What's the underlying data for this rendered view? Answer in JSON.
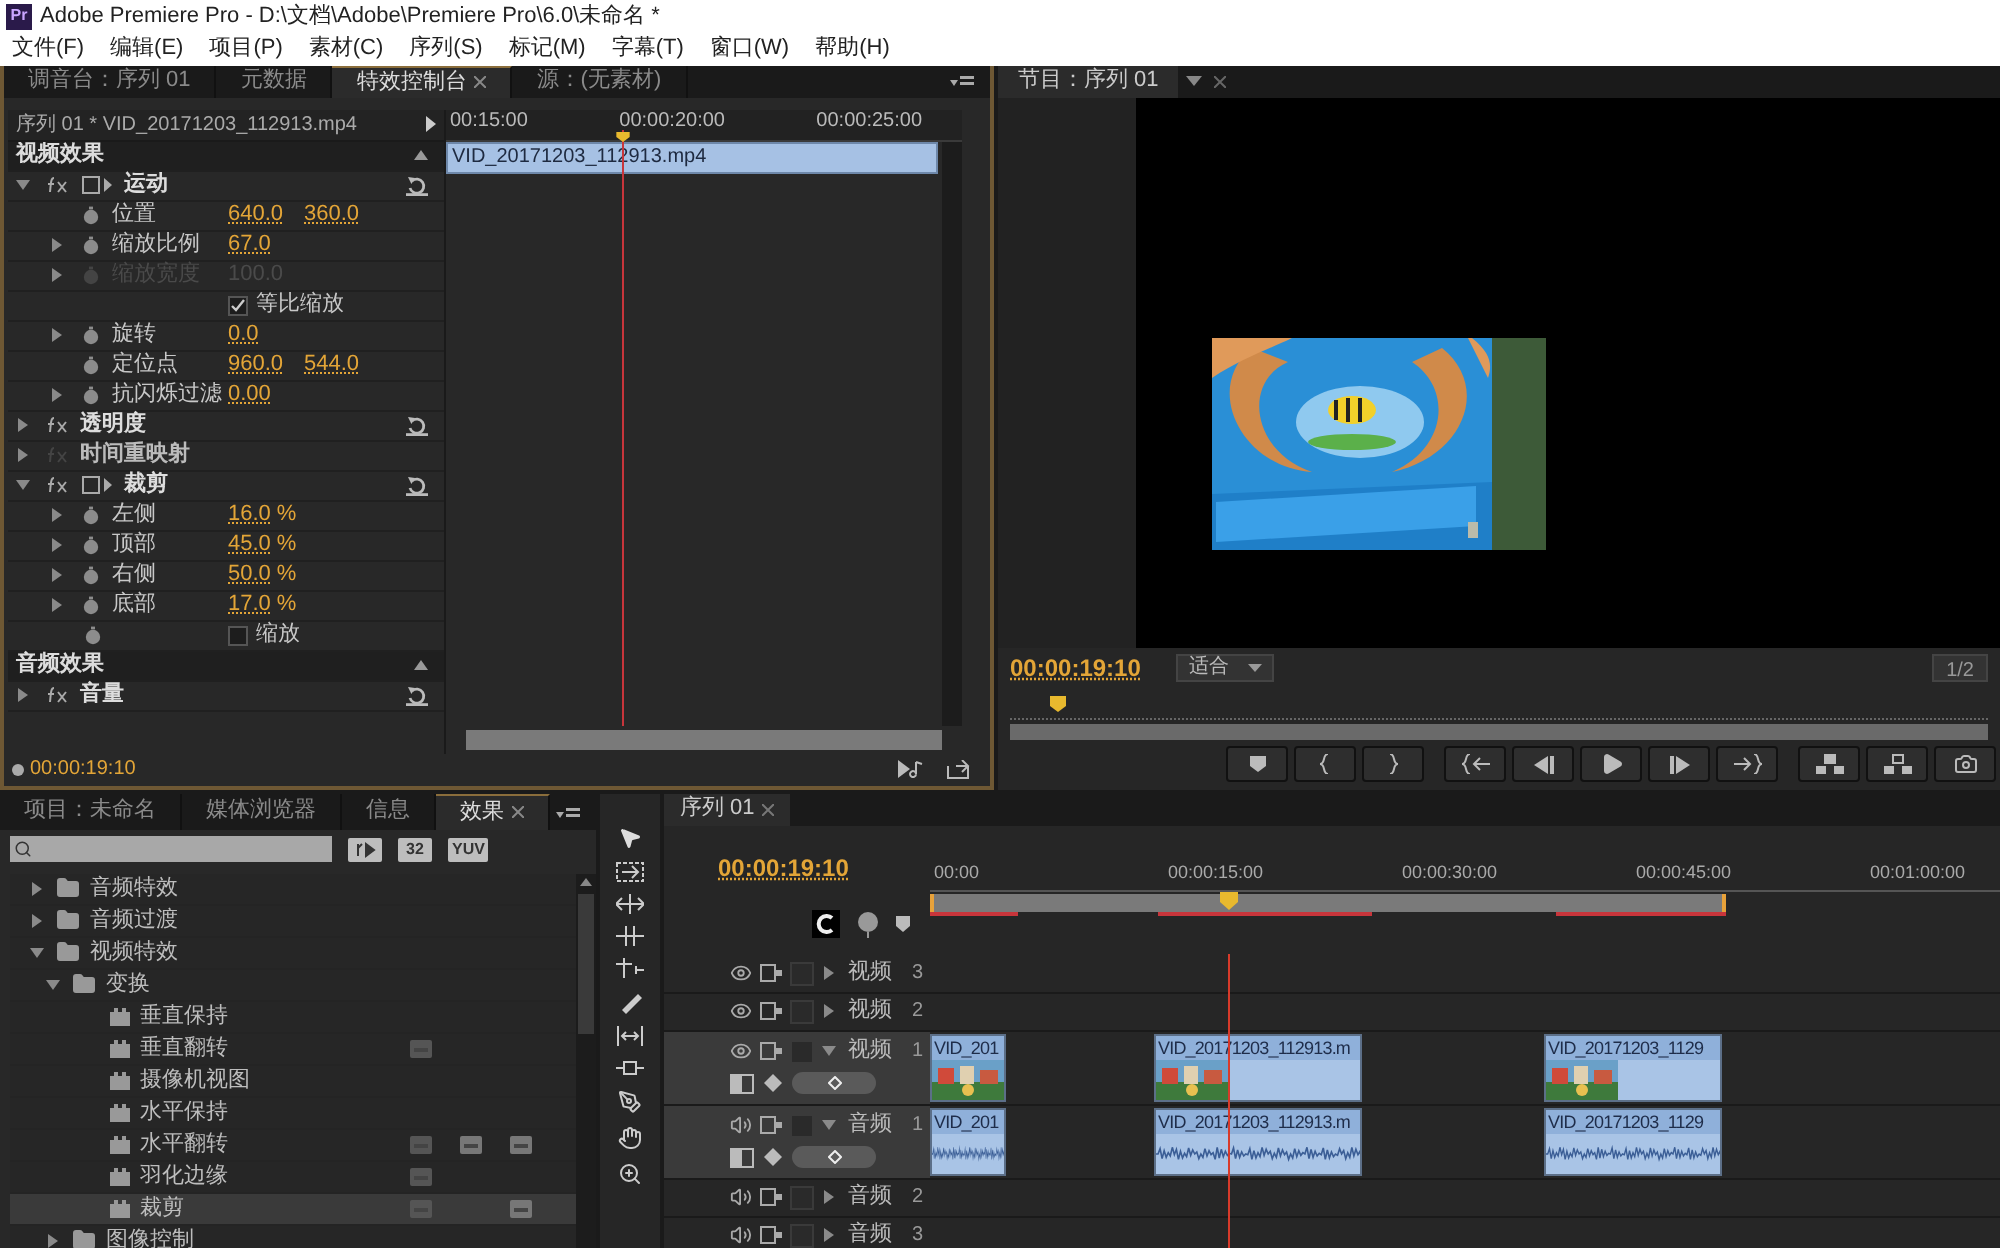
{
  "window": {
    "logo": "Pr",
    "title": "Adobe Premiere Pro - D:\\文档\\Adobe\\Premiere Pro\\6.0\\未命名 *"
  },
  "menu": [
    "文件(F)",
    "编辑(E)",
    "项目(P)",
    "素材(C)",
    "序列(S)",
    "标记(M)",
    "字幕(T)",
    "窗口(W)",
    "帮助(H)"
  ],
  "effect_controls": {
    "tabs": [
      {
        "label": "调音台：序列 01",
        "selected": false
      },
      {
        "label": "元数据",
        "selected": false
      },
      {
        "label": "特效控制台",
        "selected": true
      },
      {
        "label": "源：(无素材)",
        "selected": false
      }
    ],
    "clip_path": "序列 01 * VID_20171203_112913.mp4",
    "ruler": [
      "00:15:00",
      "00:00:20:00",
      "00:00:25:00"
    ],
    "clip_bar": "VID_20171203_112913.mp4",
    "rows": [
      {
        "kind": "section",
        "label": "视频效果"
      },
      {
        "kind": "effect",
        "label": "运动",
        "expanded": true,
        "fx_on": true,
        "transform_icon": true
      },
      {
        "kind": "param",
        "label": "位置",
        "values": [
          "640.0",
          "360.0"
        ],
        "expandable": false,
        "disabled": false
      },
      {
        "kind": "param",
        "label": "缩放比例",
        "values": [
          "67.0"
        ],
        "expandable": true,
        "disabled": false
      },
      {
        "kind": "param",
        "label": "缩放宽度",
        "values": [
          "100.0"
        ],
        "expandable": true,
        "disabled": true
      },
      {
        "kind": "check",
        "label": "等比缩放",
        "checked": true,
        "stopwatch": false
      },
      {
        "kind": "param",
        "label": "旋转",
        "values": [
          "0.0"
        ],
        "expandable": true,
        "disabled": false
      },
      {
        "kind": "param",
        "label": "定位点",
        "values": [
          "960.0",
          "544.0"
        ],
        "expandable": false,
        "disabled": false
      },
      {
        "kind": "param",
        "label": "抗闪烁过滤",
        "values": [
          "0.00"
        ],
        "expandable": true,
        "disabled": false
      },
      {
        "kind": "effect",
        "label": "透明度",
        "expanded": false,
        "fx_on": true,
        "transform_icon": false
      },
      {
        "kind": "effect",
        "label": "时间重映射",
        "expanded": false,
        "fx_on": false,
        "transform_icon": false
      },
      {
        "kind": "effect",
        "label": "裁剪",
        "expanded": true,
        "fx_on": true,
        "transform_icon": true
      },
      {
        "kind": "param",
        "label": "左侧",
        "values": [
          "16.0"
        ],
        "unit": "%",
        "expandable": true,
        "disabled": false
      },
      {
        "kind": "param",
        "label": "顶部",
        "values": [
          "45.0"
        ],
        "unit": "%",
        "expandable": true,
        "disabled": false
      },
      {
        "kind": "param",
        "label": "右侧",
        "values": [
          "50.0"
        ],
        "unit": "%",
        "expandable": true,
        "disabled": false
      },
      {
        "kind": "param",
        "label": "底部",
        "values": [
          "17.0"
        ],
        "unit": "%",
        "expandable": true,
        "disabled": false
      },
      {
        "kind": "check",
        "label": "缩放",
        "checked": false,
        "stopwatch": true
      },
      {
        "kind": "section",
        "label": "音频效果"
      },
      {
        "kind": "effect",
        "label": "音量",
        "expanded": false,
        "fx_on": true,
        "transform_icon": false
      }
    ],
    "timecode": "00:00:19:10"
  },
  "program": {
    "tab": "节目：序列 01",
    "timecode": "00:00:19:10",
    "zoom": "适合",
    "resolution": "1/2",
    "scrub": {
      "level": 0.04
    }
  },
  "effects_panel": {
    "tabs": [
      {
        "label": "项目：未命名",
        "selected": false
      },
      {
        "label": "媒体浏览器",
        "selected": false
      },
      {
        "label": "信息",
        "selected": false
      },
      {
        "label": "效果",
        "selected": true
      }
    ],
    "filters": [
      {
        "kind": "accel"
      },
      {
        "kind": "bit32",
        "label": "32"
      },
      {
        "kind": "yuv",
        "label": "YUV"
      }
    ],
    "tree": [
      {
        "kind": "folder",
        "label": "音频特效",
        "expanded": false,
        "selected": false
      },
      {
        "kind": "folder",
        "label": "音频过渡",
        "expanded": false,
        "selected": false
      },
      {
        "kind": "folder",
        "label": "视频特效",
        "expanded": true,
        "selected": false,
        "children": [
          {
            "kind": "folder",
            "label": "变换",
            "expanded": true,
            "selected": false,
            "children": [
              {
                "kind": "effect",
                "label": "垂直保持",
                "selected": false,
                "accel": false,
                "bit32": false,
                "yuv": false
              },
              {
                "kind": "effect",
                "label": "垂直翻转",
                "selected": false,
                "accel": true,
                "bit32": false,
                "yuv": false
              },
              {
                "kind": "effect",
                "label": "摄像机视图",
                "selected": false,
                "accel": false,
                "bit32": false,
                "yuv": false
              },
              {
                "kind": "effect",
                "label": "水平保持",
                "selected": false,
                "accel": false,
                "bit32": false,
                "yuv": false
              },
              {
                "kind": "effect",
                "label": "水平翻转",
                "selected": false,
                "accel": true,
                "bit32": true,
                "yuv": true
              },
              {
                "kind": "effect",
                "label": "羽化边缘",
                "selected": false,
                "accel": true,
                "bit32": false,
                "yuv": false
              },
              {
                "kind": "effect",
                "label": "裁剪",
                "selected": true,
                "accel": true,
                "bit32": false,
                "yuv": true
              }
            ]
          },
          {
            "kind": "folder",
            "label": "图像控制",
            "expanded": false,
            "selected": false
          }
        ]
      }
    ]
  },
  "timeline": {
    "tab": "序列 01",
    "timecode": "00:00:19:10",
    "ruler": [
      "00:00",
      "00:00:15:00",
      "00:00:30:00",
      "00:00:45:00",
      "00:01:00:00"
    ],
    "tracks": [
      {
        "kind": "video",
        "name": "视频",
        "number": "3",
        "expanded": false
      },
      {
        "kind": "video",
        "name": "视频",
        "number": "2",
        "expanded": false
      },
      {
        "kind": "video",
        "name": "视频",
        "number": "1",
        "expanded": true,
        "clips": [
          {
            "label": "VID_201"
          },
          {
            "label": "VID_20171203_112913.m"
          },
          {
            "label": "VID_20171203_1129"
          }
        ]
      },
      {
        "kind": "audio",
        "name": "音频",
        "number": "1",
        "expanded": true,
        "clips": [
          {
            "label": "VID_201"
          },
          {
            "label": "VID_20171203_112913.m"
          },
          {
            "label": "VID_20171203_1129"
          }
        ]
      },
      {
        "kind": "audio",
        "name": "音频",
        "number": "2",
        "expanded": false
      },
      {
        "kind": "audio",
        "name": "音频",
        "number": "3",
        "expanded": false
      }
    ]
  }
}
